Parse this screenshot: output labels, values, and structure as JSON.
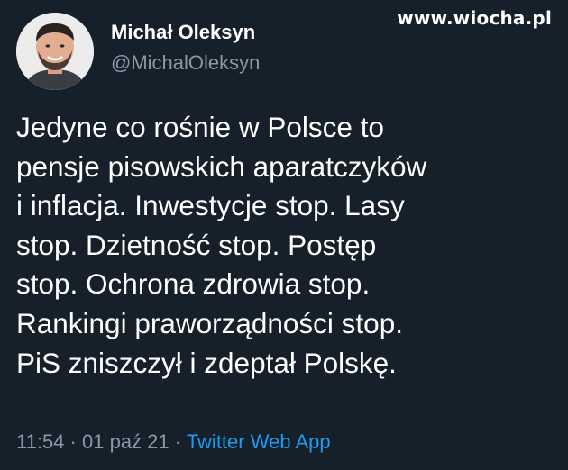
{
  "watermark": "www.wiocha.pl",
  "author": {
    "display_name": "Michał Oleksyn",
    "handle": "@MichalOleksyn"
  },
  "tweet": {
    "lines": [
      "Jedyne co rośnie w Polsce to",
      "pensje pisowskich aparatczyków",
      "i inflacja. Inwestycje stop. Lasy",
      "stop. Dzietność stop. Postęp",
      "stop. Ochrona zdrowia stop.",
      "Rankingi praworządności stop.",
      "PiS zniszczył i zdeptał Polskę."
    ],
    "time": "11:54",
    "date": "01 paź 21",
    "separator": "·",
    "source": "Twitter Web App"
  },
  "colors": {
    "background": "#15202b",
    "text": "#ffffff",
    "muted": "#8899a6",
    "link": "#1d9bf0"
  }
}
